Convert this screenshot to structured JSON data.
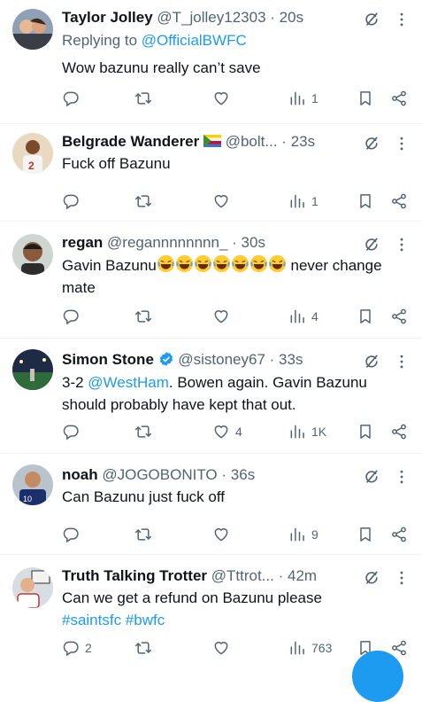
{
  "tweets": [
    {
      "name": "Taylor Jolley",
      "handle": "@T_jolley12303",
      "time": "20s",
      "reply_prefix": "Replying to ",
      "reply_to": "@OfficialBWFC",
      "text": "Wow bazunu really can’t save",
      "actions": {
        "replies": "",
        "retweets": "",
        "likes": "",
        "views": "1"
      }
    },
    {
      "name": "Belgrade Wanderer",
      "handle": "@bolt...",
      "time": "23s",
      "text": "Fuck off Bazunu",
      "actions": {
        "replies": "",
        "retweets": "",
        "likes": "",
        "views": "1"
      }
    },
    {
      "name": "regan",
      "handle": "@regannnnnnnn_",
      "time": "30s",
      "text_prefix": "Gavin Bazunu",
      "text_suffix": " never change mate",
      "emoji_count": 7,
      "actions": {
        "replies": "",
        "retweets": "",
        "likes": "",
        "views": "4"
      }
    },
    {
      "name": "Simon Stone",
      "handle": "@sistoney67",
      "time": "33s",
      "text_prefix": "3-2 ",
      "text_link": "@WestHam",
      "text_suffix": ". Bowen again. Gavin Bazunu should probably have kept that out.",
      "actions": {
        "replies": "",
        "retweets": "",
        "likes": "4",
        "views": "1K"
      }
    },
    {
      "name": "noah",
      "handle": "@JOGOBONITO",
      "time": "36s",
      "text": "Can Bazunu just fuck off",
      "actions": {
        "replies": "",
        "retweets": "",
        "likes": "",
        "views": "9"
      }
    },
    {
      "name": "Truth Talking Trotter",
      "handle": "@Tttrot...",
      "time": "42m",
      "text": "Can we get a refund on Bazunu please",
      "hashtags": "#saintsfc #bwfc",
      "actions": {
        "replies": "2",
        "retweets": "",
        "likes": "",
        "views": "763"
      }
    }
  ],
  "icons": {
    "reply": "reply-icon",
    "retweet": "retweet-icon",
    "like": "heart-icon",
    "views": "views-icon",
    "bookmark": "bookmark-icon",
    "share": "share-icon",
    "grok": "grok-icon",
    "more": "more-icon"
  },
  "colors": {
    "accent": "#1d9bf0",
    "muted": "#536471",
    "text": "#0f1419"
  }
}
